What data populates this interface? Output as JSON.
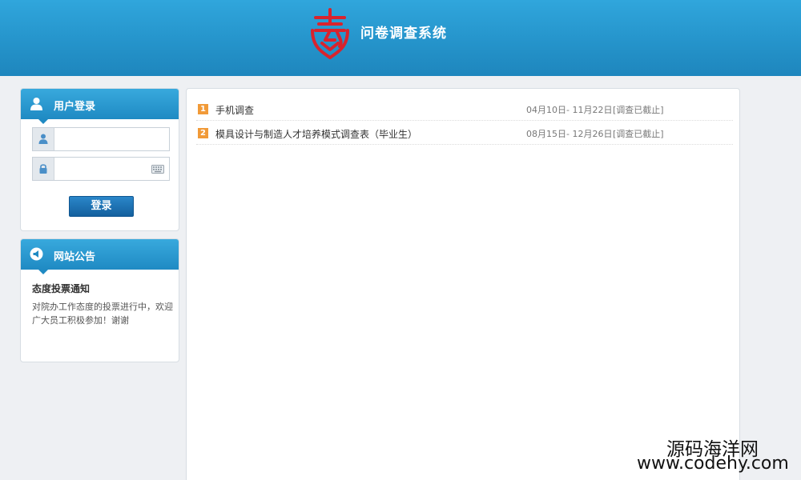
{
  "header": {
    "title": "问卷调查系统",
    "logo_icon": "school-emblem-icon"
  },
  "login": {
    "title": "用户登录",
    "username_value": "",
    "password_value": "",
    "submit_label": "登录"
  },
  "notice": {
    "title": "网站公告",
    "heading": "态度投票通知",
    "body": "对院办工作态度的投票进行中，欢迎广大员工积极参加！谢谢"
  },
  "surveys": [
    {
      "num": "1",
      "title": "手机调查",
      "date": "04月10日- 11月22日",
      "status": "[调查已截止]"
    },
    {
      "num": "2",
      "title": "模具设计与制造人才培养模式调查表（毕业生）",
      "date": "08月15日- 12月26日",
      "status": "[调查已截止]"
    }
  ],
  "watermark": {
    "line1": "源码海洋网",
    "line2": "www.codehy.com"
  },
  "colors": {
    "header_blue": "#2594cb",
    "badge_orange": "#f19a38",
    "logo_red": "#d9232d"
  }
}
